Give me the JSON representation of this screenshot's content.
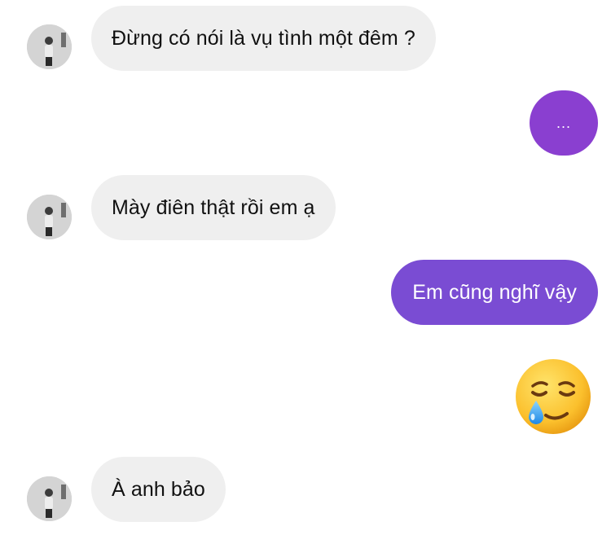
{
  "colors": {
    "incoming_bubble": "#efefef",
    "outgoing_bubble_1": "#8a3fd0",
    "outgoing_bubble_2": "#7a4cd3",
    "incoming_text": "#111111",
    "outgoing_text": "#ffffff"
  },
  "messages": [
    {
      "direction": "incoming",
      "text": "Đừng có nói là vụ tình một đêm ?",
      "avatar": "contact-avatar"
    },
    {
      "direction": "outgoing",
      "text": "..."
    },
    {
      "direction": "incoming",
      "text": "Mày điên thật rồi em ạ",
      "avatar": "contact-avatar"
    },
    {
      "direction": "outgoing",
      "text": "Em cũng nghĩ vậy"
    },
    {
      "direction": "outgoing",
      "type": "emoji",
      "emoji": "smiling-face-with-tear"
    },
    {
      "direction": "incoming",
      "text": "À anh bảo",
      "avatar": "contact-avatar"
    }
  ]
}
